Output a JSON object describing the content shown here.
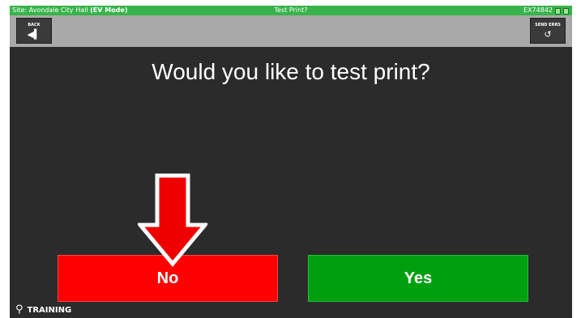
{
  "status_bar": {
    "site_label": "Site: Avondale City Hall",
    "mode_label": "(EV Mode)",
    "center_title": "Test Print?",
    "device_id": "EX74842",
    "status_icons": [
      "battery-icon",
      "printer-icon"
    ]
  },
  "toolbar": {
    "back_label": "BACK",
    "back_icon": "back-icon",
    "send_label": "SEND ERRS",
    "send_icon": "refresh-icon"
  },
  "prompt": "Would you like to test print?",
  "buttons": {
    "no_label": "No",
    "yes_label": "Yes"
  },
  "training_label": "TRAINING",
  "colors": {
    "status_green": "#37b34a",
    "no_red": "#ff0000",
    "yes_green": "#009f0f",
    "background": "#2b2b2b",
    "annotation_arrow": "#ee0000"
  }
}
